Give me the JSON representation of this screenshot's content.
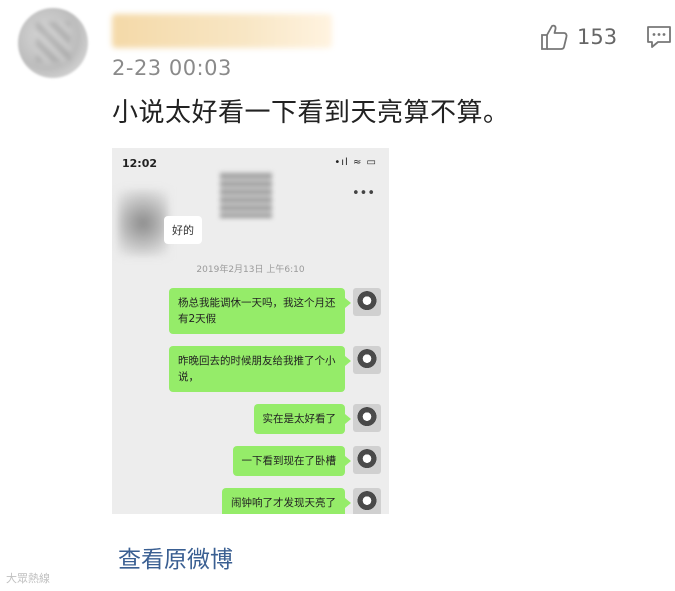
{
  "post": {
    "username": "",
    "timestamp": "2-23 00:03",
    "text": "小说太好看一下看到天亮算不算。",
    "like_count": "153",
    "view_original_label": "查看原微博"
  },
  "chat_screenshot": {
    "status_time": "12:02",
    "status_signal": "•ıl ≈ ▭",
    "received_message": "好的",
    "date_divider": "2019年2月13日 上午6:10",
    "sent_messages": [
      "杨总我能调休一天吗，我这个月还有2天假",
      "昨晚回去的时候朋友给我推了个小说，",
      "实在是太好看了",
      "一下看到现在了卧槽",
      "闹钟响了才发现天亮了"
    ]
  },
  "watermark": "大眾熱線",
  "icons": {
    "like": "thumbs-up-icon",
    "comment": "comment-icon"
  },
  "colors": {
    "link": "#3a5f92",
    "bubble_green": "#95ec69",
    "chat_bg": "#ededed"
  }
}
